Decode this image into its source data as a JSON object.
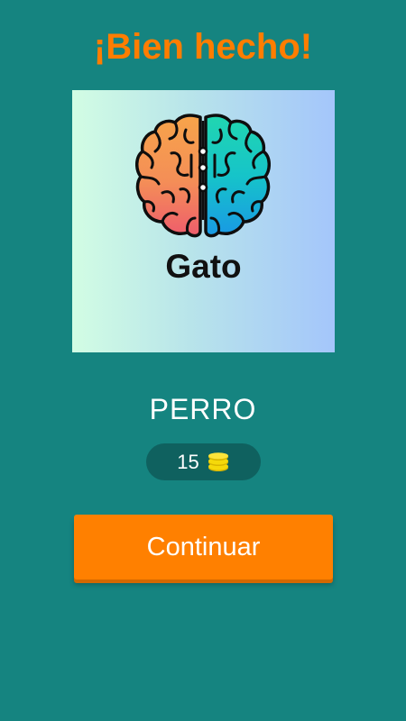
{
  "header": {
    "title": "¡Bien hecho!",
    "title_color": "#ff7d00"
  },
  "puzzle_card": {
    "icon": "brain-icon",
    "word": "Gato"
  },
  "answer": {
    "text": "PERRO"
  },
  "reward": {
    "amount": "15",
    "icon": "coins-icon"
  },
  "actions": {
    "continue_label": "Continuar",
    "button_color": "#ff8000"
  },
  "colors": {
    "background": "#158480",
    "reward_pill": "#0f615f"
  }
}
